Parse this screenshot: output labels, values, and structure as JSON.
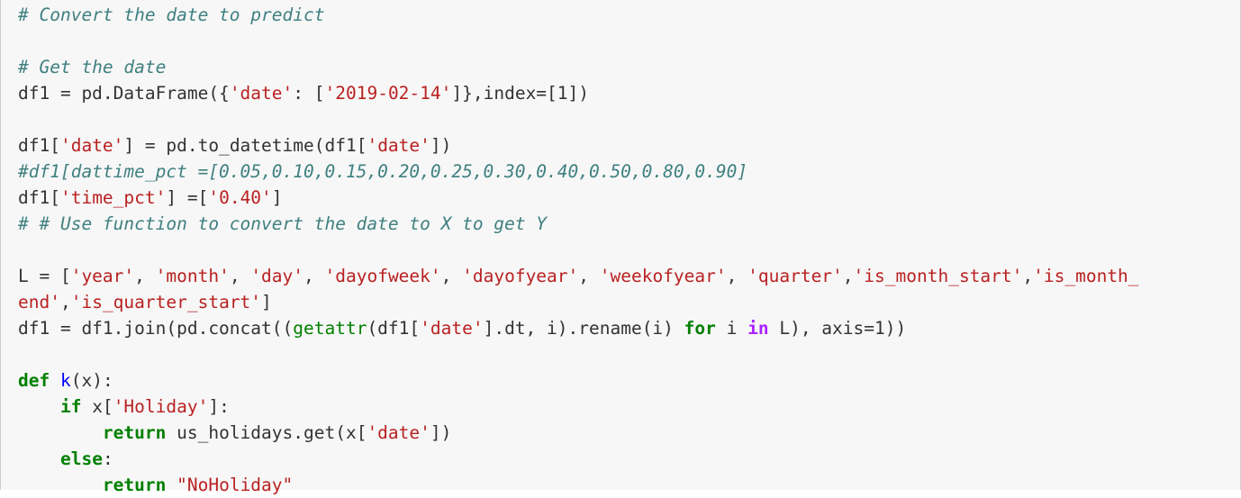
{
  "colors": {
    "cell_background": "#f7f7f7",
    "comment": "#408080",
    "string": "#ba2121",
    "keyword": "#008000",
    "builtin": "#008000",
    "def_name": "#0000ff",
    "operator_keyword": "#aa22ff",
    "default_text": "#333333"
  },
  "code_lines": [
    [
      {
        "t": "# Convert the date to predict",
        "k": "comment"
      }
    ],
    [],
    [
      {
        "t": "# Get the date",
        "k": "comment"
      }
    ],
    [
      {
        "t": "df1 = pd.DataFrame({",
        "k": "text"
      },
      {
        "t": "'date'",
        "k": "string"
      },
      {
        "t": ": [",
        "k": "text"
      },
      {
        "t": "'2019-02-14'",
        "k": "string"
      },
      {
        "t": "]},index=[1])",
        "k": "text"
      }
    ],
    [],
    [
      {
        "t": "df1[",
        "k": "text"
      },
      {
        "t": "'date'",
        "k": "string"
      },
      {
        "t": "] = pd.to_datetime(df1[",
        "k": "text"
      },
      {
        "t": "'date'",
        "k": "string"
      },
      {
        "t": "])",
        "k": "text"
      }
    ],
    [
      {
        "t": "#df1[dattime_pct =[0.05,0.10,0.15,0.20,0.25,0.30,0.40,0.50,0.80,0.90]",
        "k": "comment"
      }
    ],
    [
      {
        "t": "df1[",
        "k": "text"
      },
      {
        "t": "'time_pct'",
        "k": "string"
      },
      {
        "t": "] =[",
        "k": "text"
      },
      {
        "t": "'0.40'",
        "k": "string"
      },
      {
        "t": "]",
        "k": "text"
      }
    ],
    [
      {
        "t": "# # Use function to convert the date to X to get Y",
        "k": "comment"
      }
    ],
    [],
    [
      {
        "t": "L = [",
        "k": "text"
      },
      {
        "t": "'year'",
        "k": "string"
      },
      {
        "t": ", ",
        "k": "text"
      },
      {
        "t": "'month'",
        "k": "string"
      },
      {
        "t": ", ",
        "k": "text"
      },
      {
        "t": "'day'",
        "k": "string"
      },
      {
        "t": ", ",
        "k": "text"
      },
      {
        "t": "'dayofweek'",
        "k": "string"
      },
      {
        "t": ", ",
        "k": "text"
      },
      {
        "t": "'dayofyear'",
        "k": "string"
      },
      {
        "t": ", ",
        "k": "text"
      },
      {
        "t": "'weekofyear'",
        "k": "string"
      },
      {
        "t": ", ",
        "k": "text"
      },
      {
        "t": "'quarter'",
        "k": "string"
      },
      {
        "t": ",",
        "k": "text"
      },
      {
        "t": "'is_month_start'",
        "k": "string"
      },
      {
        "t": ",",
        "k": "text"
      },
      {
        "t": "'is_month_",
        "k": "string"
      }
    ],
    [
      {
        "t": "end'",
        "k": "string"
      },
      {
        "t": ",",
        "k": "text"
      },
      {
        "t": "'is_quarter_start'",
        "k": "string"
      },
      {
        "t": "]",
        "k": "text"
      }
    ],
    [
      {
        "t": "df1 = df1.join(pd.concat((",
        "k": "text"
      },
      {
        "t": "getattr",
        "k": "builtin"
      },
      {
        "t": "(df1[",
        "k": "text"
      },
      {
        "t": "'date'",
        "k": "string"
      },
      {
        "t": "].dt, i).rename(i) ",
        "k": "text"
      },
      {
        "t": "for",
        "k": "keyword"
      },
      {
        "t": " i ",
        "k": "text"
      },
      {
        "t": "in",
        "k": "op-kw"
      },
      {
        "t": " L), axis=1))",
        "k": "text"
      }
    ],
    [],
    [
      {
        "t": "def",
        "k": "keyword"
      },
      {
        "t": " ",
        "k": "text"
      },
      {
        "t": "k",
        "k": "def"
      },
      {
        "t": "(x):",
        "k": "text"
      }
    ],
    [
      {
        "t": "    ",
        "k": "text"
      },
      {
        "t": "if",
        "k": "keyword"
      },
      {
        "t": " x[",
        "k": "text"
      },
      {
        "t": "'Holiday'",
        "k": "string"
      },
      {
        "t": "]:",
        "k": "text"
      }
    ],
    [
      {
        "t": "        ",
        "k": "text"
      },
      {
        "t": "return",
        "k": "keyword"
      },
      {
        "t": " us_holidays.get(x[",
        "k": "text"
      },
      {
        "t": "'date'",
        "k": "string"
      },
      {
        "t": "])",
        "k": "text"
      }
    ],
    [
      {
        "t": "    ",
        "k": "text"
      },
      {
        "t": "else",
        "k": "keyword"
      },
      {
        "t": ":",
        "k": "text"
      }
    ],
    [
      {
        "t": "        ",
        "k": "text"
      },
      {
        "t": "return",
        "k": "keyword"
      },
      {
        "t": " ",
        "k": "text"
      },
      {
        "t": "\"NoHoliday\"",
        "k": "string"
      }
    ]
  ]
}
